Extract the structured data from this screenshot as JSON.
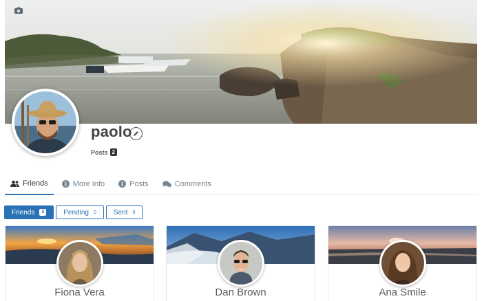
{
  "profile": {
    "username": "paolo",
    "posts_label": "Posts",
    "posts_count": "2"
  },
  "tabs": [
    {
      "label": "Friends",
      "icon": "users-icon",
      "active": true
    },
    {
      "label": "More Info",
      "icon": "info-icon",
      "active": false
    },
    {
      "label": "Posts",
      "icon": "info-icon",
      "active": false
    },
    {
      "label": "Comments",
      "icon": "comments-icon",
      "active": false
    }
  ],
  "filters": [
    {
      "label": "Friends",
      "count": "3",
      "active": true
    },
    {
      "label": "Pending",
      "count": "0",
      "active": false
    },
    {
      "label": "Sent",
      "count": "0",
      "active": false
    }
  ],
  "friends": [
    {
      "name": "Fiona Vera"
    },
    {
      "name": "Dan Brown"
    },
    {
      "name": "Ana Smile"
    }
  ],
  "colors": {
    "accent": "#2a72b5",
    "tab_inactive": "#7a8691"
  }
}
